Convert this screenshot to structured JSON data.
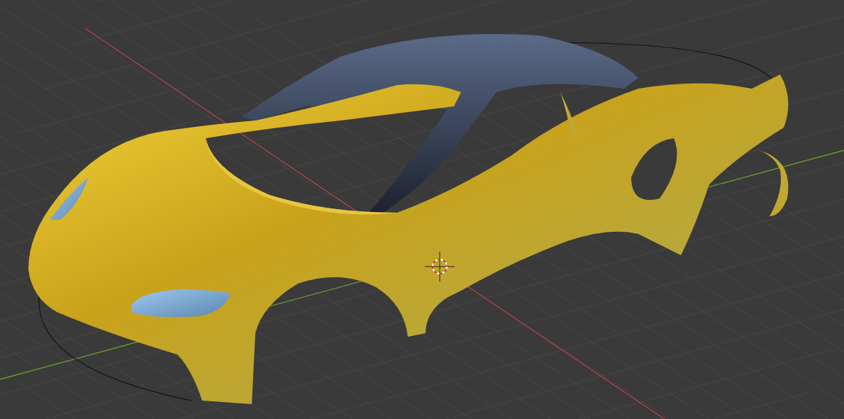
{
  "viewport": {
    "show_grid": true,
    "show_axes": true,
    "show_cursor": true
  }
}
